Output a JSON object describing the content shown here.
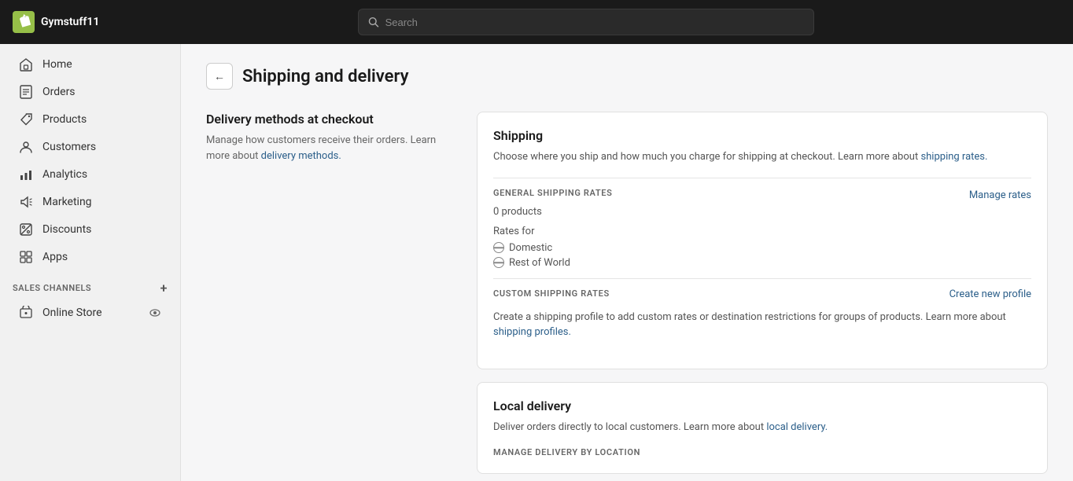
{
  "brand": {
    "name": "Gymstuff11",
    "logo_alt": "Shopify logo"
  },
  "search": {
    "placeholder": "Search"
  },
  "sidebar": {
    "items": [
      {
        "id": "home",
        "label": "Home",
        "icon": "home"
      },
      {
        "id": "orders",
        "label": "Orders",
        "icon": "orders"
      },
      {
        "id": "products",
        "label": "Products",
        "icon": "tag"
      },
      {
        "id": "customers",
        "label": "Customers",
        "icon": "person"
      },
      {
        "id": "analytics",
        "label": "Analytics",
        "icon": "chart"
      },
      {
        "id": "marketing",
        "label": "Marketing",
        "icon": "megaphone"
      },
      {
        "id": "discounts",
        "label": "Discounts",
        "icon": "discount"
      },
      {
        "id": "apps",
        "label": "Apps",
        "icon": "apps"
      }
    ],
    "sales_channels_label": "SALES CHANNELS",
    "online_store_label": "Online Store"
  },
  "page": {
    "title": "Shipping and delivery",
    "back_label": "←"
  },
  "delivery_methods": {
    "heading": "Delivery methods at checkout",
    "description": "Manage how customers receive their orders. Learn more about",
    "link_text": "delivery methods.",
    "link_href": "#"
  },
  "shipping_card": {
    "title": "Shipping",
    "description": "Choose where you ship and how much you charge for shipping at checkout. Learn more about",
    "link_text": "shipping rates.",
    "link_href": "#",
    "general_label": "GENERAL SHIPPING RATES",
    "product_count": "0 products",
    "manage_rates_label": "Manage rates",
    "rates_for_label": "Rates for",
    "rate_domestic": "Domestic",
    "rate_rest_of_world": "Rest of World",
    "custom_label": "CUSTOM SHIPPING RATES",
    "custom_description": "Create a shipping profile to add custom rates or destination restrictions for groups of products. Learn more about",
    "custom_link_text": "shipping profiles.",
    "custom_link_href": "#",
    "create_new_label": "Create new profile"
  },
  "local_delivery_card": {
    "title": "Local delivery",
    "description": "Deliver orders directly to local customers. Learn more about",
    "link_text": "local delivery.",
    "link_href": "#",
    "manage_label": "MANAGE DELIVERY BY LOCATION"
  }
}
